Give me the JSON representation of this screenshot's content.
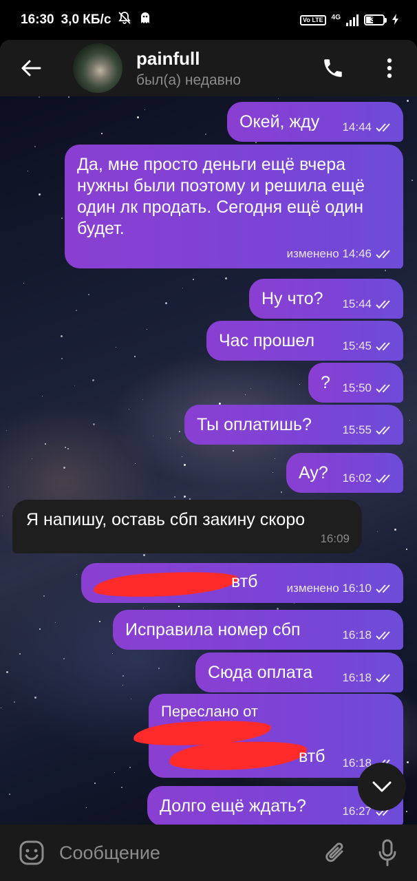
{
  "status_bar": {
    "time": "16:30",
    "speed": "3,0 КБ/с",
    "network": "4G",
    "volte": "Vo LTE",
    "battery": "39"
  },
  "header": {
    "title": "painfull",
    "subtitle": "был(а) недавно"
  },
  "messages": [
    {
      "text": "Окей, жду",
      "time": "14:44",
      "direction": "outgoing"
    },
    {
      "text": "Да, мне просто деньги ещё вчера нужны были поэтому и решила ещё один лк продать. Сегодня ещё один будет.",
      "time": "изменено 14:46",
      "direction": "outgoing"
    },
    {
      "text": "Ну что?",
      "time": "15:44",
      "direction": "outgoing"
    },
    {
      "text": "Час прошел",
      "time": "15:45",
      "direction": "outgoing"
    },
    {
      "text": "?",
      "time": "15:50",
      "direction": "outgoing"
    },
    {
      "text": "Ты оплатишь?",
      "time": "15:55",
      "direction": "outgoing"
    },
    {
      "text": "Ау?",
      "time": "16:02",
      "direction": "outgoing"
    },
    {
      "text": "Я напишу, оставь сбп закину скоро",
      "time": "16:09",
      "direction": "incoming"
    },
    {
      "text": "втб",
      "time": "изменено 16:10",
      "direction": "outgoing"
    },
    {
      "text": "Исправила номер сбп",
      "time": "16:18",
      "direction": "outgoing"
    },
    {
      "text": "Сюда оплата",
      "time": "16:18",
      "direction": "outgoing"
    },
    {
      "forward_label": "Переслано от",
      "text": "втб",
      "time": "16:18",
      "direction": "outgoing"
    },
    {
      "text": "Долго ещё ждать?",
      "time": "16:27",
      "direction": "outgoing"
    }
  ],
  "input": {
    "placeholder": "Сообщение"
  },
  "colors": {
    "outgoing_bubble": "#7b44d6",
    "incoming_bubble": "#1e1e1e",
    "header_bg": "#1a1a1a",
    "redaction": "#ff2a2a"
  },
  "icons": [
    "back-arrow-icon",
    "phone-icon",
    "more-vert-icon",
    "chevron-down-icon",
    "emoji-icon",
    "attach-icon",
    "mic-icon",
    "double-check-icon"
  ]
}
